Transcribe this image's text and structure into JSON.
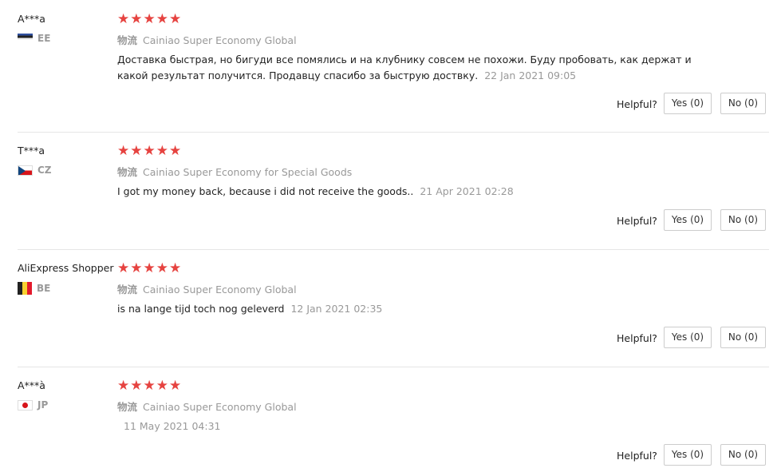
{
  "helpful_label": "Helpful?",
  "star_color": "#e64340",
  "reviews": [
    {
      "user": "A***a",
      "country": "EE",
      "stars": "★★★★★",
      "logistics_cn": "物流",
      "logistics": "Cainiao Super Economy Global",
      "text": "Доставка быстрая, но бигуди все помялись и на клубнику совсем не похожи. Буду пробовать, как держат и какой результат получится. Продавцу спасибо за быструю доствку.",
      "date": "22 Jan 2021 09:05",
      "yes": "Yes (0)",
      "no": "No (0)"
    },
    {
      "user": "T***a",
      "country": "CZ",
      "stars": "★★★★★",
      "logistics_cn": "物流",
      "logistics": "Cainiao Super Economy for Special Goods",
      "text": "I got my money back, because i did not receive the goods..",
      "date": "21 Apr 2021 02:28",
      "yes": "Yes (0)",
      "no": "No (0)"
    },
    {
      "user": "AliExpress Shopper",
      "country": "BE",
      "stars": "★★★★★",
      "logistics_cn": "物流",
      "logistics": "Cainiao Super Economy Global",
      "text": "is na lange tijd toch nog geleverd",
      "date": "12 Jan 2021 02:35",
      "yes": "Yes (0)",
      "no": "No (0)"
    },
    {
      "user": "A***à",
      "country": "JP",
      "stars": "★★★★★",
      "logistics_cn": "物流",
      "logistics": "Cainiao Super Economy Global",
      "text": "",
      "date": "11 May 2021 04:31",
      "yes": "Yes (0)",
      "no": "No (0)"
    }
  ]
}
